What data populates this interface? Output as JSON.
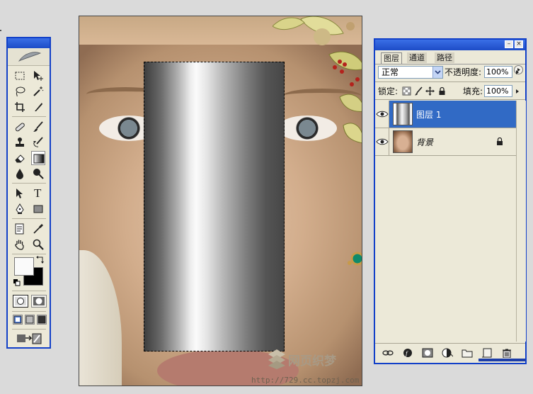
{
  "toolbox": {
    "tools": [
      {
        "name": "marquee-icon"
      },
      {
        "name": "move-icon"
      },
      {
        "name": "lasso-icon"
      },
      {
        "name": "magic-wand-icon"
      },
      {
        "name": "crop-icon"
      },
      {
        "name": "slice-icon"
      },
      {
        "name": "healing-brush-icon"
      },
      {
        "name": "brush-icon"
      },
      {
        "name": "clone-stamp-icon"
      },
      {
        "name": "history-brush-icon"
      },
      {
        "name": "eraser-icon"
      },
      {
        "name": "gradient-icon"
      },
      {
        "name": "blur-icon"
      },
      {
        "name": "dodge-icon"
      },
      {
        "name": "path-select-icon"
      },
      {
        "name": "type-icon"
      },
      {
        "name": "pen-icon"
      },
      {
        "name": "rectangle-shape-icon"
      },
      {
        "name": "notes-icon"
      },
      {
        "name": "eyedropper-icon"
      },
      {
        "name": "hand-icon"
      },
      {
        "name": "zoom-icon"
      }
    ],
    "type_glyph": "T",
    "selected_tool": "gradient-icon",
    "foreground_color": "#fafafa",
    "background_color": "#000000"
  },
  "document": {
    "watermark_text": "网页织梦",
    "url_text": "http://729.cc.topzj.com"
  },
  "layers_panel": {
    "tabs": [
      "图层",
      "通道",
      "路径"
    ],
    "active_tab": 0,
    "blend_mode": "正常",
    "opacity_label": "不透明度:",
    "opacity_value": "100%",
    "lock_label": "锁定:",
    "fill_label": "填充:",
    "fill_value": "100%",
    "layers": [
      {
        "name": "图层 1",
        "selected": true
      },
      {
        "name": "背景",
        "selected": false,
        "locked": true
      }
    ],
    "accent_color": "#316ac5"
  }
}
